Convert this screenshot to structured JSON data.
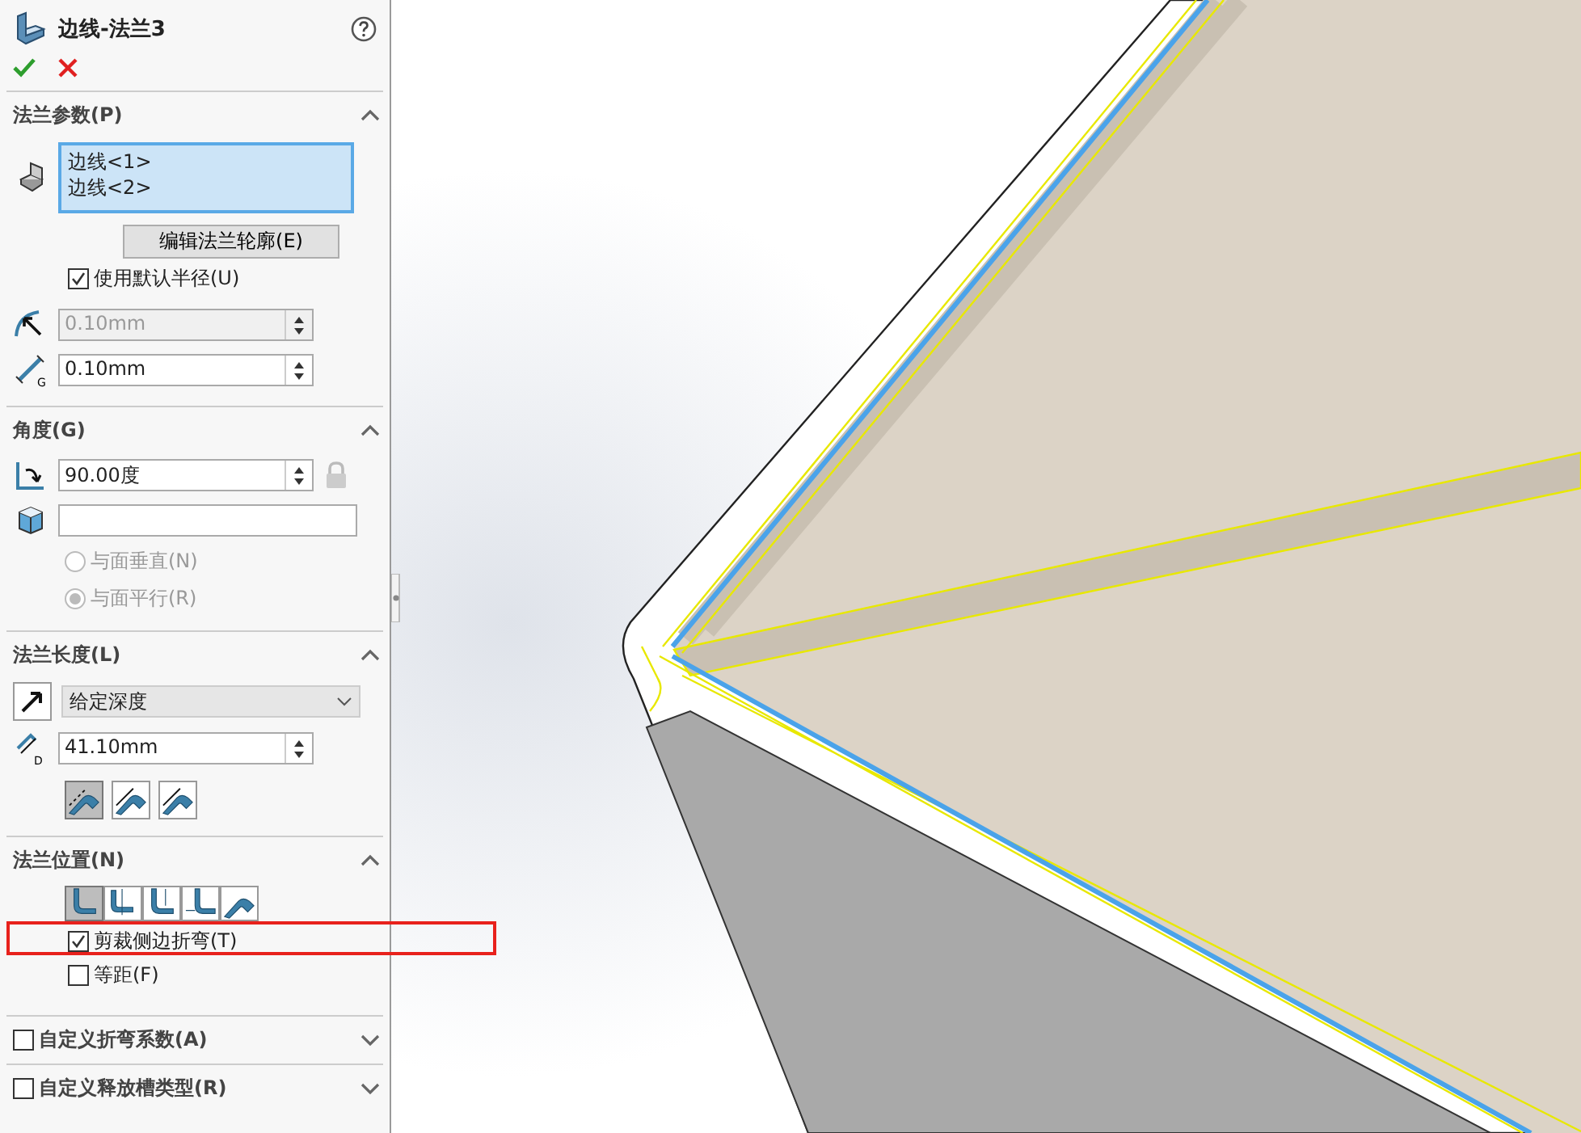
{
  "property_manager": {
    "title": "边线-法兰3",
    "flange_parameters": {
      "title": "法兰参数(P)",
      "expanded": true,
      "edges": [
        "边线<1>",
        "边线<2>"
      ],
      "edit_profile_button": "编辑法兰轮廓(E)",
      "use_default_radius": {
        "label": "使用默认半径(U)",
        "checked": true
      },
      "radius": {
        "value": "0.10mm",
        "disabled": true
      },
      "gap": {
        "value": "0.10mm",
        "disabled": false,
        "icon_letter": "G"
      }
    },
    "angle": {
      "title": "角度(G)",
      "expanded": true,
      "value": "90.00度",
      "options": [
        {
          "label": "与面垂直(N)",
          "selected": false,
          "disabled": true
        },
        {
          "label": "与面平行(R)",
          "selected": true,
          "disabled": true
        }
      ]
    },
    "flange_length": {
      "title": "法兰长度(L)",
      "expanded": true,
      "end_condition": "给定深度",
      "length": "41.10mm",
      "length_icon_letter": "D",
      "length_modes": [
        {
          "selected": true
        },
        {
          "selected": false
        },
        {
          "selected": false
        }
      ]
    },
    "flange_position": {
      "title": "法兰位置(N)",
      "expanded": true,
      "positions": [
        {
          "selected": true
        },
        {
          "selected": false
        },
        {
          "selected": false
        },
        {
          "selected": false
        },
        {
          "selected": false
        }
      ],
      "checkboxes": [
        {
          "label": "剪裁侧边折弯(T)",
          "checked": true,
          "highlighted": true
        },
        {
          "label": "等距(F)",
          "checked": false,
          "highlighted": false
        }
      ]
    },
    "collapsed_sections": [
      {
        "title": "自定义折弯系数(A)",
        "checked": false,
        "expanded": false
      },
      {
        "title": "自定义释放槽类型(R)",
        "checked": false,
        "expanded": false
      }
    ]
  }
}
